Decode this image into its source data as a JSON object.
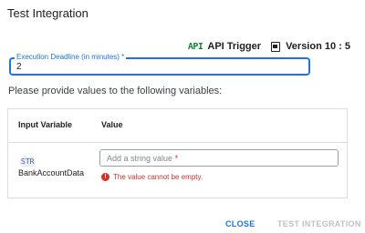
{
  "dialog": {
    "title": "Test Integration"
  },
  "meta": {
    "api_icon": "API",
    "trigger_label": "API Trigger",
    "version_icon": "version-icon",
    "version_label": "Version 10 : 5"
  },
  "deadline": {
    "label": "Execution Deadline (in minutes) *",
    "value": "2"
  },
  "instructions": "Please provide values to the following variables:",
  "table": {
    "headers": [
      "Input Variable",
      "Value"
    ],
    "rows": [
      {
        "type_icon": "STR",
        "variable": "BankAccountData",
        "placeholder": "Add a string value",
        "required_marker": "*",
        "error": "The value cannot be empty.",
        "error_icon": "!"
      }
    ]
  },
  "buttons": {
    "close": "CLOSE",
    "test": "TEST INTEGRATION"
  },
  "colors": {
    "accent": "#1a73e8",
    "error": "#d93025",
    "api_green": "#188038",
    "disabled": "#bdc1c6"
  }
}
